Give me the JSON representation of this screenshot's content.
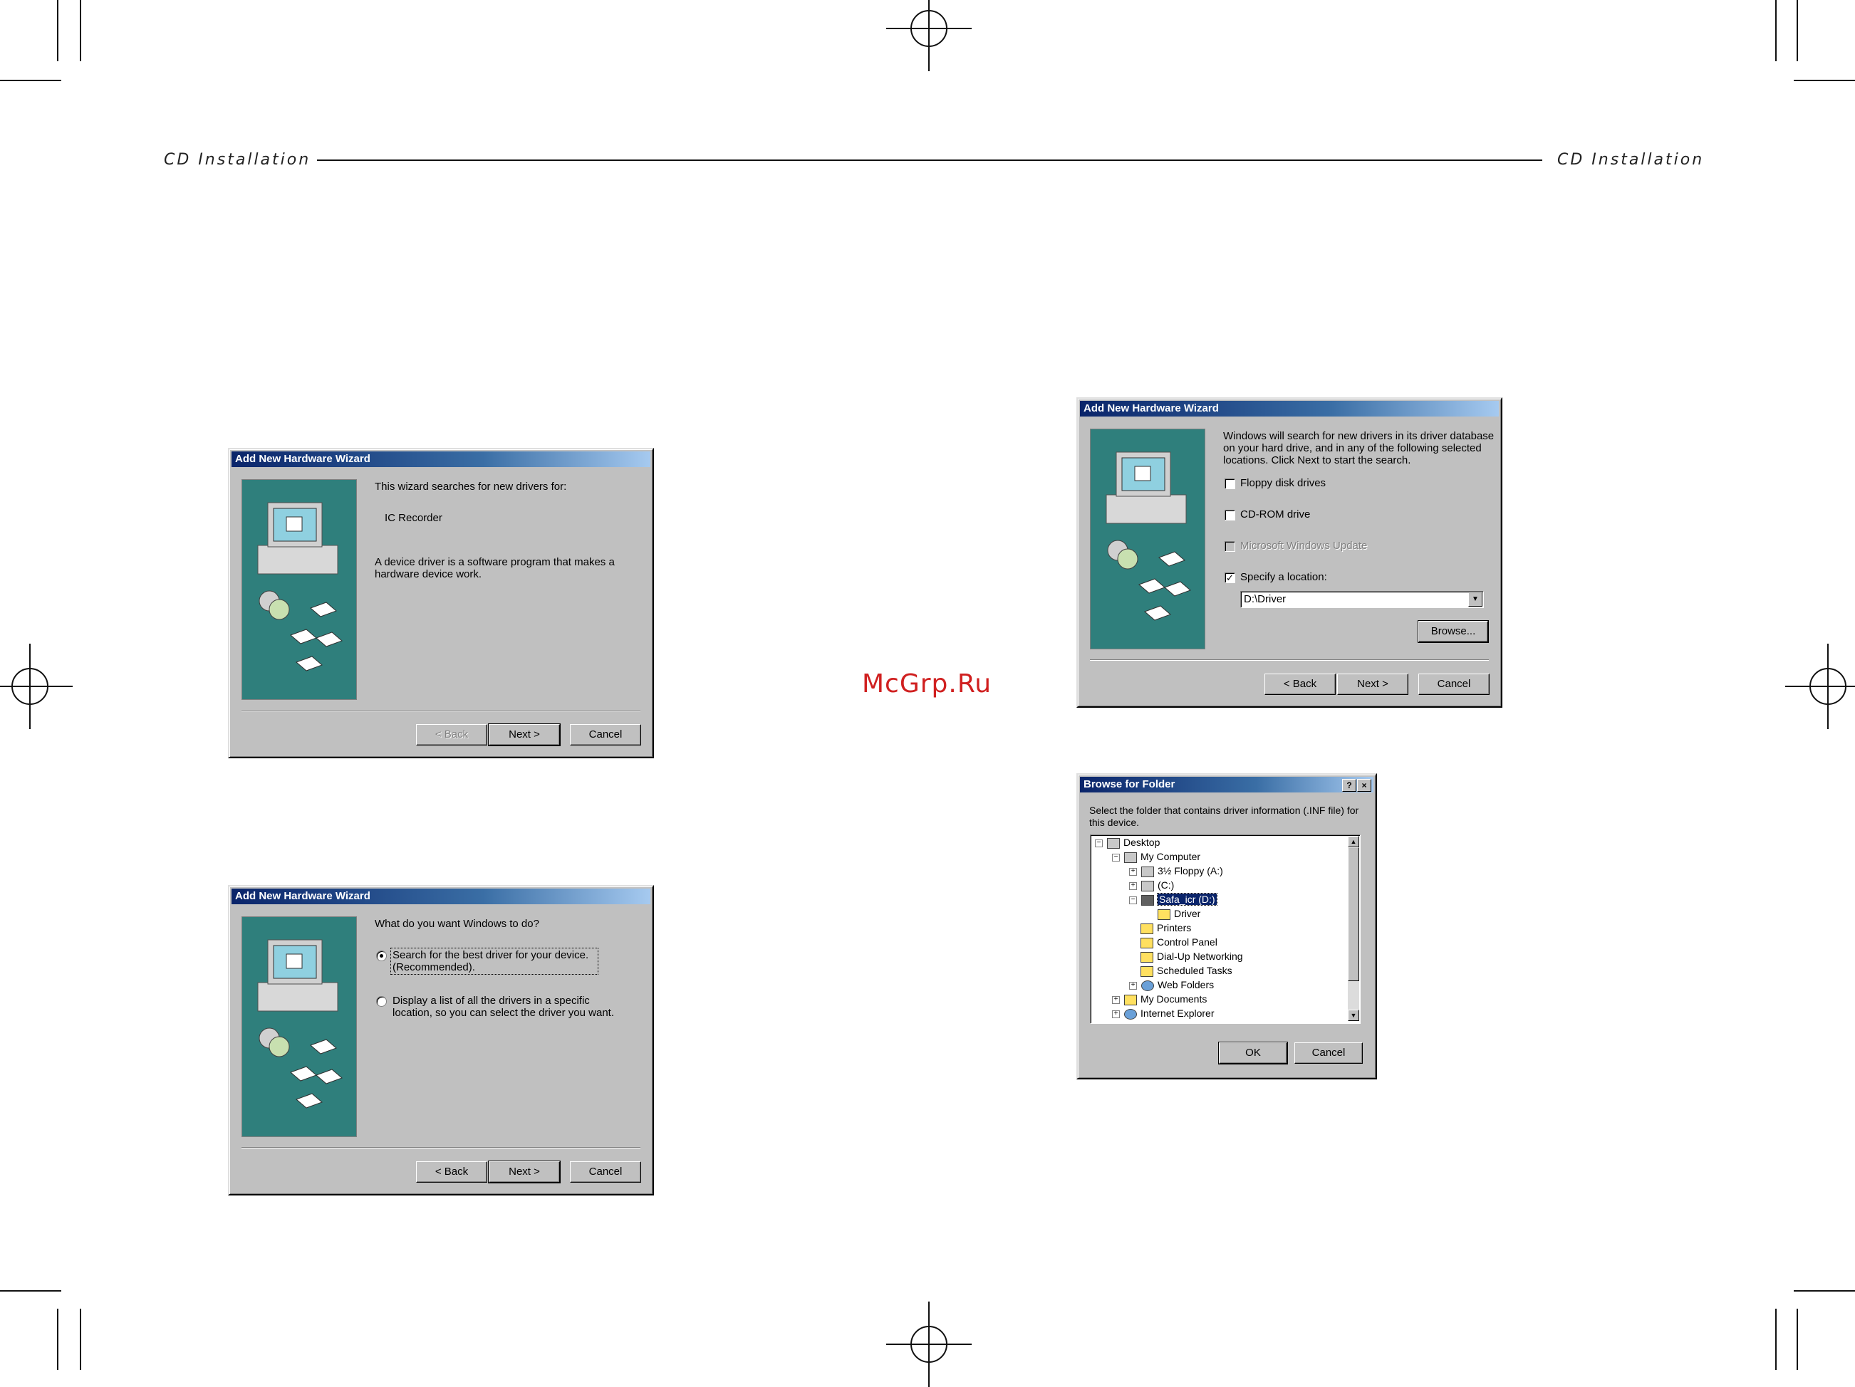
{
  "page": {
    "header_left": "CD Installation",
    "header_right": "CD Installation",
    "watermark": "McGrp.Ru"
  },
  "dialog1": {
    "title": "Add New Hardware Wizard",
    "line1": "This wizard searches for new drivers for:",
    "device": "IC Recorder",
    "desc1": "A device driver is a software program that makes a",
    "desc2": "hardware device work.",
    "back": "< Back",
    "next": "Next >",
    "cancel": "Cancel"
  },
  "dialog2": {
    "title": "Add New Hardware Wizard",
    "question": "What do you want Windows to do?",
    "option1_line1": "Search for the best driver for your device.",
    "option1_line2": "(Recommended).",
    "option2_line1": "Display a list of all the drivers in a specific",
    "option2_line2": "location, so you can select the driver you want.",
    "back": "< Back",
    "next": "Next >",
    "cancel": "Cancel"
  },
  "dialog3": {
    "title": "Add New Hardware Wizard",
    "intro1": "Windows will search for new drivers in its driver database",
    "intro2": "on your hard drive, and in any of the following selected",
    "intro3": "locations. Click Next to start the search.",
    "opt_floppy": "Floppy disk drives",
    "opt_cdrom": "CD-ROM drive",
    "opt_update": "Microsoft Windows Update",
    "opt_location": "Specify a location:",
    "location_value": "D:\\Driver",
    "browse": "Browse...",
    "back": "< Back",
    "next": "Next >",
    "cancel": "Cancel"
  },
  "dialog4": {
    "title": "Browse for Folder",
    "help": "?",
    "close": "×",
    "prompt1": "Select the folder that contains driver information (.INF file) for",
    "prompt2": "this device.",
    "tree": {
      "desktop": "Desktop",
      "my_computer": "My Computer",
      "floppy": "3½ Floppy (A:)",
      "c_drive": "(C:)",
      "d_drive": "Safa_icr (D:)",
      "driver": "Driver",
      "printers": "Printers",
      "control_panel": "Control Panel",
      "dialup": "Dial-Up Networking",
      "scheduled": "Scheduled Tasks",
      "web_folders": "Web Folders",
      "my_documents": "My Documents",
      "ie": "Internet Explorer"
    },
    "ok": "OK",
    "cancel": "Cancel"
  },
  "colors": {
    "titlebar_start": "#0a246a",
    "dialog_face": "#c0c0c0",
    "wizard_art": "#2f7f7c",
    "watermark": "#d02020"
  }
}
